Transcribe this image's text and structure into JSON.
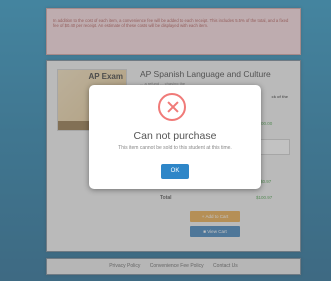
{
  "notice": {
    "text": "In addition to the cost of each item, a convenience fee will be added to each receipt. This includes 5.5% of the total, and a fixed fee of $0.40 per receipt. An estimate of these costs will be displayed with each item."
  },
  "product": {
    "title": "AP Spanish Language and Culture",
    "thumb_label": "AP Exam",
    "description": "... a refund ... chasing the",
    "section_label": "ck of the",
    "price": "$100.00",
    "fee": "$0.97",
    "total_label": "Total",
    "total": "$100.97",
    "add_to_cart": "Add to Cart",
    "view_cart": "View Cart"
  },
  "footer": {
    "links": [
      "Privacy Policy",
      "Convenience Fee Policy",
      "Contact Us"
    ]
  },
  "modal": {
    "title": "Can not purchase",
    "message": "This item cannot be sold to this student at this time.",
    "ok_label": "OK",
    "icon": "error-x-icon",
    "icon_color": "#f07a78",
    "button_color": "#2e86c8"
  }
}
